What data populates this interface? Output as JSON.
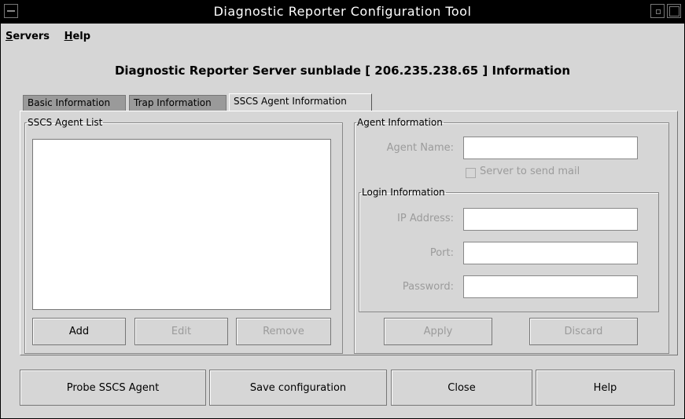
{
  "window": {
    "title": "Diagnostic Reporter Configuration Tool"
  },
  "menu": [
    {
      "label": "Servers",
      "mnemonic": "S",
      "rest": "ervers"
    },
    {
      "label": "Help",
      "mnemonic": "H",
      "rest": "elp"
    }
  ],
  "heading": "Diagnostic Reporter Server sunblade  [ 206.235.238.65 ]  Information",
  "tabs": [
    {
      "label": "Basic Information",
      "active": false
    },
    {
      "label": "Trap Information",
      "active": false
    },
    {
      "label": "SSCS Agent Information",
      "active": true
    }
  ],
  "agent_list": {
    "title": "SSCS Agent List",
    "items": [],
    "buttons": {
      "add": "Add",
      "edit": "Edit",
      "remove": "Remove"
    }
  },
  "agent_info": {
    "title": "Agent Information",
    "agent_name_label": "Agent Name:",
    "agent_name_value": "",
    "server_mail_label": "Server to send mail",
    "server_mail_checked": false,
    "login": {
      "title": "Login Information",
      "ip_label": "IP Address:",
      "ip_value": "",
      "port_label": "Port:",
      "port_value": "",
      "password_label": "Password:",
      "password_value": ""
    },
    "buttons": {
      "apply": "Apply",
      "discard": "Discard"
    }
  },
  "bottom_buttons": {
    "probe": "Probe SSCS Agent",
    "save": "Save configuration",
    "close": "Close",
    "help": "Help"
  },
  "colors": {
    "background": "#d6d6d6",
    "titlebar": "#000000",
    "disabled_text": "#9b9b9b",
    "inactive_tab": "#9a9a9a"
  }
}
